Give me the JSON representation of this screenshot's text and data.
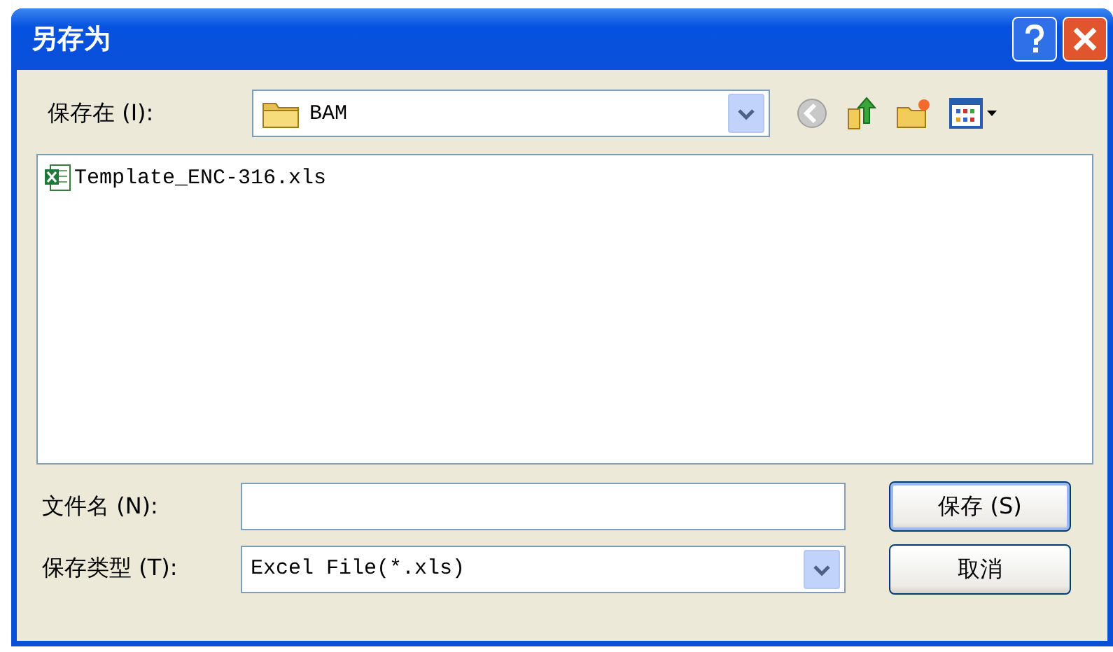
{
  "window": {
    "title": "另存为"
  },
  "look_in": {
    "label": "保存在 (I):",
    "value": "BAM"
  },
  "files": [
    {
      "name": "Template_ENC-316.xls",
      "selected": false
    }
  ],
  "file_name": {
    "label": "文件名 (N):"
  },
  "file_type": {
    "label": "保存类型 (T):",
    "value": "Excel File(*.xls)"
  },
  "buttons": [
    {
      "label": "保存 (S)",
      "default": true
    },
    {
      "label": "取消",
      "default": false
    }
  ]
}
